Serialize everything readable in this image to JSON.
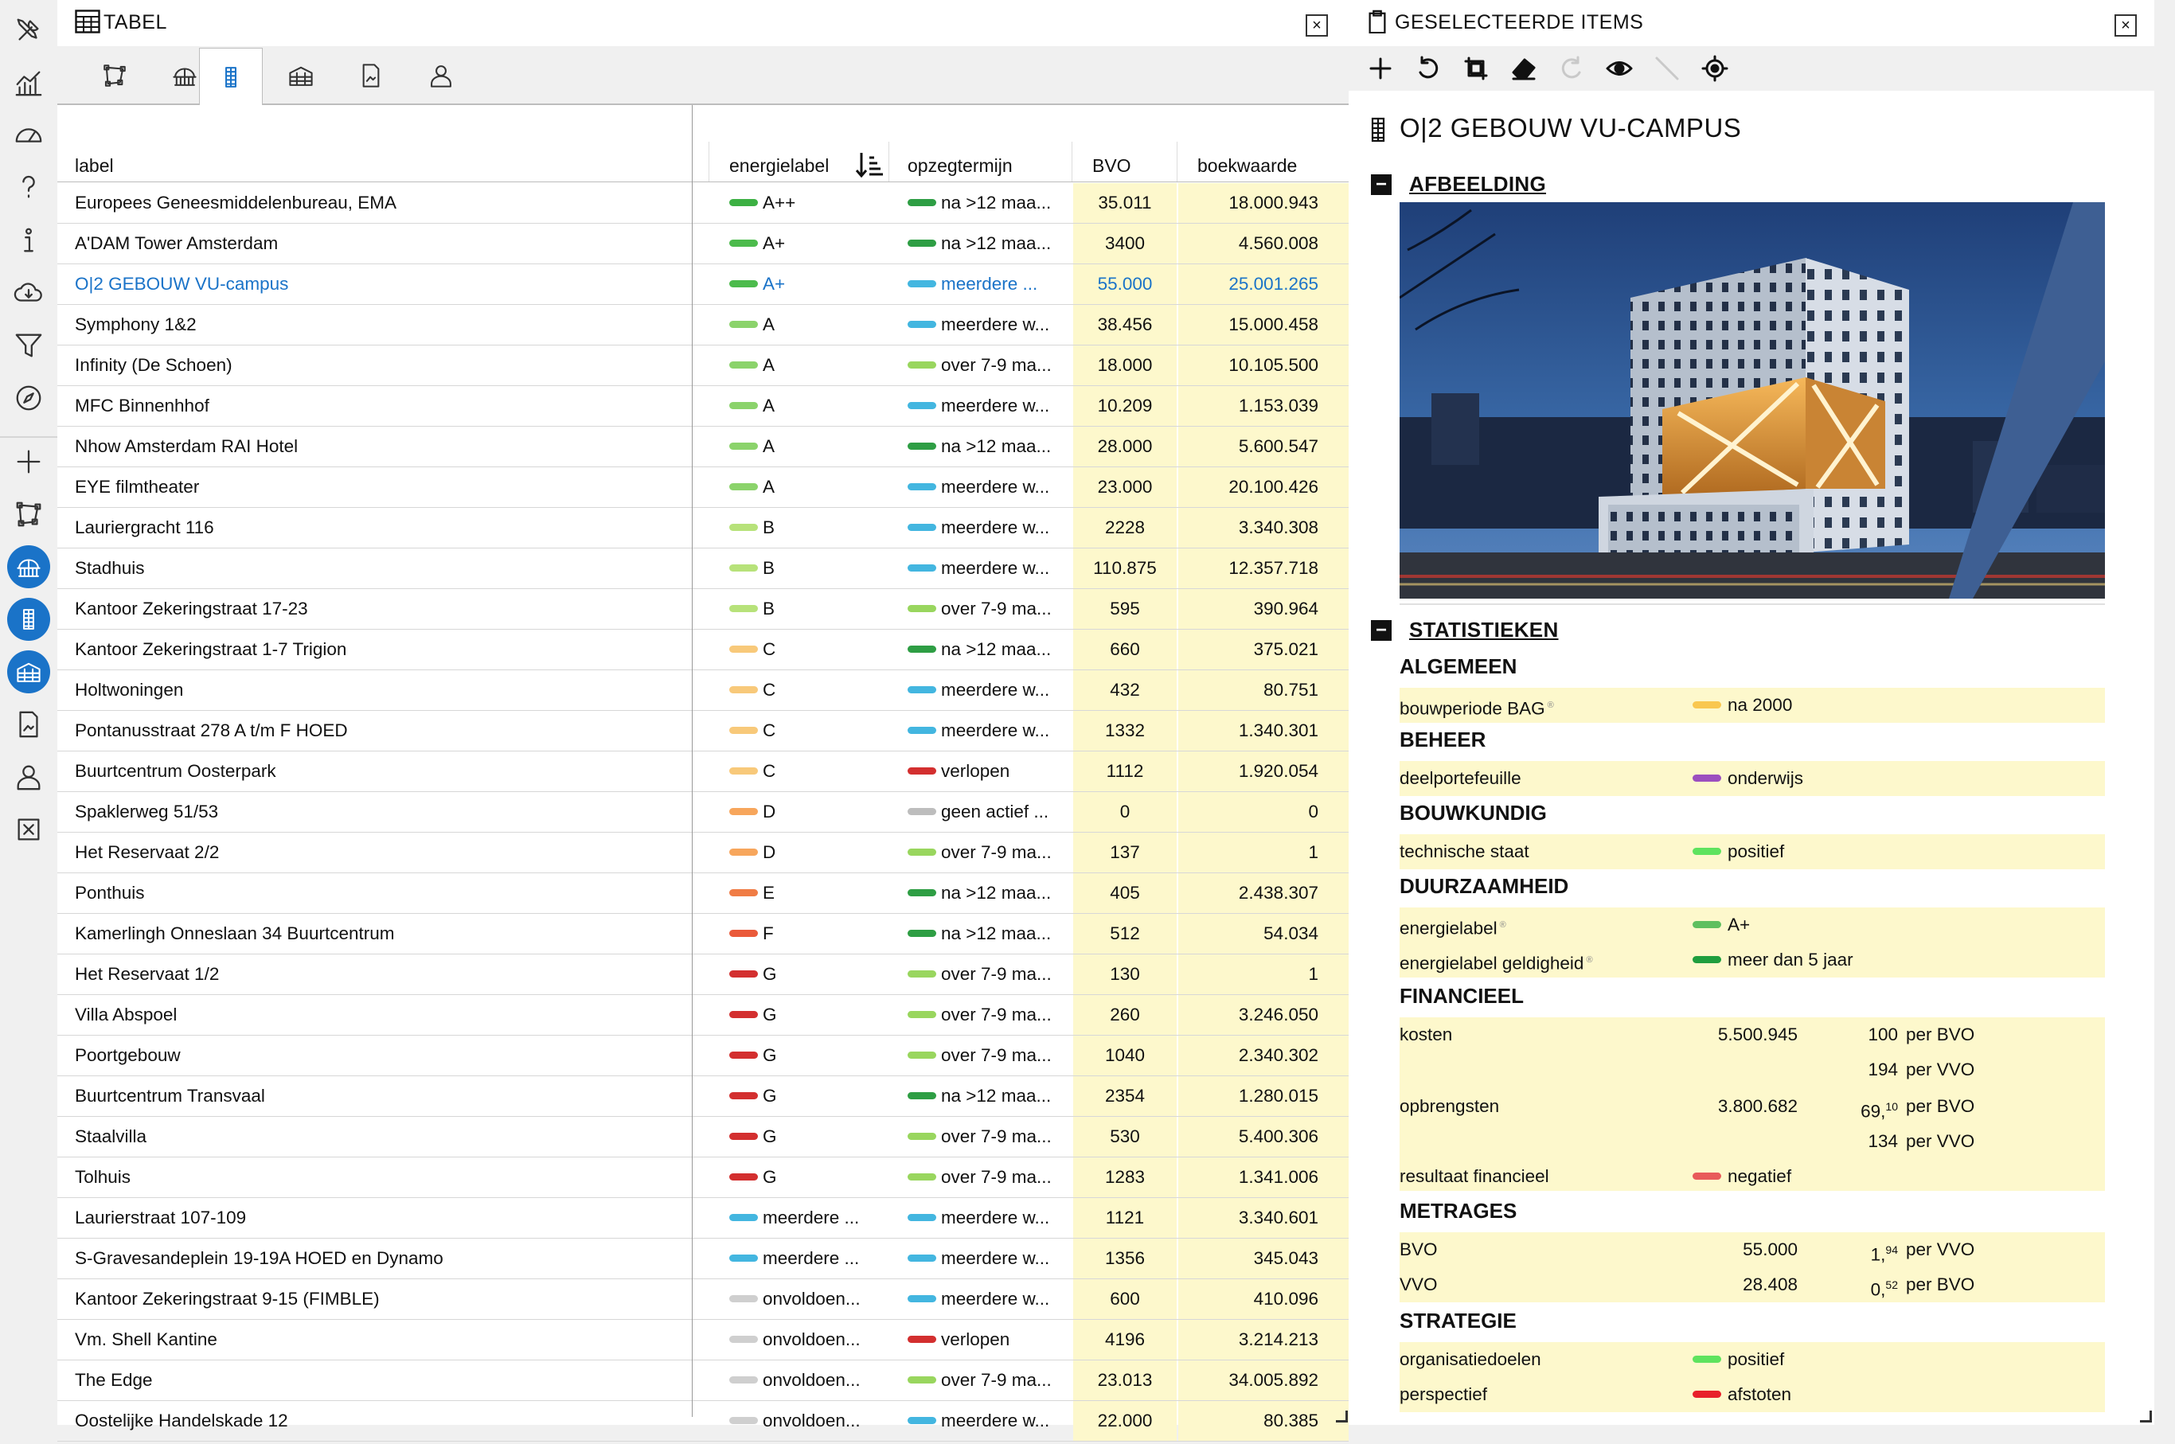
{
  "table_panel": {
    "title": "TABEL",
    "close_label": "×",
    "columns": {
      "label": "label",
      "energielabel": "energielabel",
      "opzegtermijn": "opzegtermijn",
      "bvo": "BVO",
      "boekwaarde": "boekwaarde"
    },
    "rows": [
      {
        "label": "Europees Geneesmiddelenbureau, EMA",
        "en": "A++",
        "en_color": "#3cb043",
        "op": "na >12 maa...",
        "op_color": "#2e9e44",
        "bvo": "35.011",
        "bw": "18.000.943"
      },
      {
        "label": "A'DAM Tower Amsterdam",
        "en": "A+",
        "en_color": "#4cbb4c",
        "op": "na >12 maa...",
        "op_color": "#2e9e44",
        "bvo": "3400",
        "bw": "4.560.008"
      },
      {
        "label": "O|2 GEBOUW VU-campus",
        "en": "A+",
        "en_color": "#4cbb4c",
        "op": "meerdere ...",
        "op_color": "#43b6e0",
        "bvo": "55.000",
        "bw": "25.001.265",
        "selected": true
      },
      {
        "label": "Symphony 1&2",
        "en": "A",
        "en_color": "#8bd36b",
        "op": "meerdere w...",
        "op_color": "#43b6e0",
        "bvo": "38.456",
        "bw": "15.000.458"
      },
      {
        "label": "Infinity (De Schoen)",
        "en": "A",
        "en_color": "#8bd36b",
        "op": "over 7-9 ma...",
        "op_color": "#99d65e",
        "bvo": "18.000",
        "bw": "10.105.500"
      },
      {
        "label": "MFC Binnenhhof",
        "en": "A",
        "en_color": "#8bd36b",
        "op": "meerdere w...",
        "op_color": "#43b6e0",
        "bvo": "10.209",
        "bw": "1.153.039"
      },
      {
        "label": "Nhow Amsterdam RAI Hotel",
        "en": "A",
        "en_color": "#8bd36b",
        "op": "na >12 maa...",
        "op_color": "#2e9e44",
        "bvo": "28.000",
        "bw": "5.600.547"
      },
      {
        "label": "EYE filmtheater",
        "en": "A",
        "en_color": "#8bd36b",
        "op": "meerdere w...",
        "op_color": "#43b6e0",
        "bvo": "23.000",
        "bw": "20.100.426"
      },
      {
        "label": "Lauriergracht 116",
        "en": "B",
        "en_color": "#b7e27a",
        "op": "meerdere w...",
        "op_color": "#43b6e0",
        "bvo": "2228",
        "bw": "3.340.308"
      },
      {
        "label": "Stadhuis",
        "en": "B",
        "en_color": "#b7e27a",
        "op": "meerdere w...",
        "op_color": "#43b6e0",
        "bvo": "110.875",
        "bw": "12.357.718"
      },
      {
        "label": "Kantoor Zekeringstraat 17-23",
        "en": "B",
        "en_color": "#b7e27a",
        "op": "over 7-9 ma...",
        "op_color": "#99d65e",
        "bvo": "595",
        "bw": "390.964"
      },
      {
        "label": "Kantoor Zekeringstraat 1-7 Trigion",
        "en": "C",
        "en_color": "#f8c97a",
        "op": "na >12 maa...",
        "op_color": "#2e9e44",
        "bvo": "660",
        "bw": "375.021"
      },
      {
        "label": "Holtwoningen",
        "en": "C",
        "en_color": "#f8c97a",
        "op": "meerdere w...",
        "op_color": "#43b6e0",
        "bvo": "432",
        "bw": "80.751"
      },
      {
        "label": "Pontanusstraat 278 A t/m F HOED",
        "en": "C",
        "en_color": "#f8c97a",
        "op": "meerdere w...",
        "op_color": "#43b6e0",
        "bvo": "1332",
        "bw": "1.340.301"
      },
      {
        "label": "Buurtcentrum Oosterpark",
        "en": "C",
        "en_color": "#f8c97a",
        "op": "verlopen",
        "op_color": "#d32f2f",
        "bvo": "1112",
        "bw": "1.920.054"
      },
      {
        "label": "Spaklerweg 51/53",
        "en": "D",
        "en_color": "#f7a65c",
        "op": "geen actief ...",
        "op_color": "#bdbdbd",
        "bvo": "0",
        "bw": "0"
      },
      {
        "label": "Het Reservaat 2/2",
        "en": "D",
        "en_color": "#f7a65c",
        "op": "over 7-9 ma...",
        "op_color": "#99d65e",
        "bvo": "137",
        "bw": "1"
      },
      {
        "label": "Ponthuis",
        "en": "E",
        "en_color": "#f07c45",
        "op": "na >12 maa...",
        "op_color": "#2e9e44",
        "bvo": "405",
        "bw": "2.438.307"
      },
      {
        "label": "Kamerlingh Onneslaan 34 Buurtcentrum",
        "en": "F",
        "en_color": "#ea5a3a",
        "op": "na >12 maa...",
        "op_color": "#2e9e44",
        "bvo": "512",
        "bw": "54.034"
      },
      {
        "label": "Het Reservaat 1/2",
        "en": "G",
        "en_color": "#d32f2f",
        "op": "over 7-9 ma...",
        "op_color": "#99d65e",
        "bvo": "130",
        "bw": "1"
      },
      {
        "label": "Villa Abspoel",
        "en": "G",
        "en_color": "#d32f2f",
        "op": "over 7-9 ma...",
        "op_color": "#99d65e",
        "bvo": "260",
        "bw": "3.246.050"
      },
      {
        "label": "Poortgebouw",
        "en": "G",
        "en_color": "#d32f2f",
        "op": "over 7-9 ma...",
        "op_color": "#99d65e",
        "bvo": "1040",
        "bw": "2.340.302"
      },
      {
        "label": "Buurtcentrum Transvaal",
        "en": "G",
        "en_color": "#d32f2f",
        "op": "na >12 maa...",
        "op_color": "#2e9e44",
        "bvo": "2354",
        "bw": "1.280.015"
      },
      {
        "label": "Staalvilla",
        "en": "G",
        "en_color": "#d32f2f",
        "op": "over 7-9 ma...",
        "op_color": "#99d65e",
        "bvo": "530",
        "bw": "5.400.306"
      },
      {
        "label": "Tolhuis",
        "en": "G",
        "en_color": "#d32f2f",
        "op": "over 7-9 ma...",
        "op_color": "#99d65e",
        "bvo": "1283",
        "bw": "1.341.006"
      },
      {
        "label": "Laurierstraat 107-109",
        "en": "meerdere ...",
        "en_color": "#43b6e0",
        "op": "meerdere w...",
        "op_color": "#43b6e0",
        "bvo": "1121",
        "bw": "3.340.601"
      },
      {
        "label": "S-Gravesandeplein 19-19A HOED en Dynamo",
        "en": "meerdere ...",
        "en_color": "#43b6e0",
        "op": "meerdere w...",
        "op_color": "#43b6e0",
        "bvo": "1356",
        "bw": "345.043"
      },
      {
        "label": "Kantoor Zekeringstraat 9-15 (FIMBLE)",
        "en": "onvoldoen...",
        "en_color": "#cfcfcf",
        "op": "meerdere w...",
        "op_color": "#43b6e0",
        "bvo": "600",
        "bw": "410.096"
      },
      {
        "label": "Vm. Shell Kantine",
        "en": "onvoldoen...",
        "en_color": "#cfcfcf",
        "op": "verlopen",
        "op_color": "#d32f2f",
        "bvo": "4196",
        "bw": "3.214.213"
      },
      {
        "label": "The Edge",
        "en": "onvoldoen...",
        "en_color": "#cfcfcf",
        "op": "over 7-9 ma...",
        "op_color": "#99d65e",
        "bvo": "23.013",
        "bw": "34.005.892"
      },
      {
        "label": "Oostelijke Handelskade 12",
        "en": "onvoldoen...",
        "en_color": "#cfcfcf",
        "op": "meerdere w...",
        "op_color": "#43b6e0",
        "bvo": "22.000",
        "bw": "80.385"
      }
    ]
  },
  "detail_panel": {
    "title": "GESELECTEERDE ITEMS",
    "close_label": "×",
    "item_title": "O|2 GEBOUW VU-CAMPUS",
    "section_image": "AFBEELDING",
    "section_stats": "STATISTIEKEN",
    "collapse_label": "−",
    "groups": {
      "algemeen": "ALGEMEEN",
      "beheer": "BEHEER",
      "bouwkundig": "BOUWKUNDIG",
      "duurzaamheid": "DUURZAAMHEID",
      "financieel": "FINANCIEEL",
      "metrages": "METRAGES",
      "strategie": "STRATEGIE"
    },
    "stats": {
      "bouwperiode": {
        "key": "bouwperiode BAG",
        "value": "na 2000",
        "color": "#f9c74f"
      },
      "deelportefeuille": {
        "key": "deelportefeuille",
        "value": "onderwijs",
        "color": "#9b4fbf"
      },
      "technische_staat": {
        "key": "technische staat",
        "value": "positief",
        "color": "#5ee35e"
      },
      "energielabel": {
        "key": "energielabel",
        "value": "A+",
        "color": "#5fbf5f"
      },
      "energielabel_geldigheid": {
        "key": "energielabel geldigheid",
        "value": "meer dan 5 jaar",
        "color": "#1f9e3e"
      },
      "kosten": {
        "key": "kosten",
        "total": "5.500.945",
        "r1_num": "100",
        "r1_unit": "per BVO",
        "r2_num": "194",
        "r2_unit": "per VVO"
      },
      "opbrengsten": {
        "key": "opbrengsten",
        "total": "3.800.682",
        "r1_num": "69,",
        "r1_dec": "10",
        "r1_unit": "per BVO",
        "r2_num": "134",
        "r2_unit": "per VVO"
      },
      "resultaat": {
        "key": "resultaat financieel",
        "value": "negatief",
        "color": "#e85a5a"
      },
      "bvo": {
        "key": "BVO",
        "total": "55.000",
        "r_num": "1,",
        "r_dec": "94",
        "r_unit": "per VVO"
      },
      "vvo": {
        "key": "VVO",
        "total": "28.408",
        "r_num": "0,",
        "r_dec": "52",
        "r_unit": "per BVO"
      },
      "organisatiedoelen": {
        "key": "organisatiedoelen",
        "value": "positief",
        "color": "#5ee35e"
      },
      "perspectief": {
        "key": "perspectief",
        "value": "afstoten",
        "color": "#e8202a"
      }
    },
    "info_marker": "®"
  },
  "icons": {
    "rail": [
      "tools-icon",
      "chart-icon",
      "gauge-icon",
      "help-icon",
      "info-icon",
      "cloud-download-icon",
      "filter-icon",
      "compass-icon",
      "plus-icon",
      "polygon-icon",
      "building-globe-icon",
      "building-tower-icon",
      "building-block-icon",
      "document-icon",
      "person-icon",
      "close-box-icon"
    ],
    "toolbar": [
      "add-icon",
      "undo-icon",
      "crop-icon",
      "eraser-icon",
      "redo-icon",
      "eye-icon",
      "line-icon",
      "locate-icon"
    ]
  }
}
